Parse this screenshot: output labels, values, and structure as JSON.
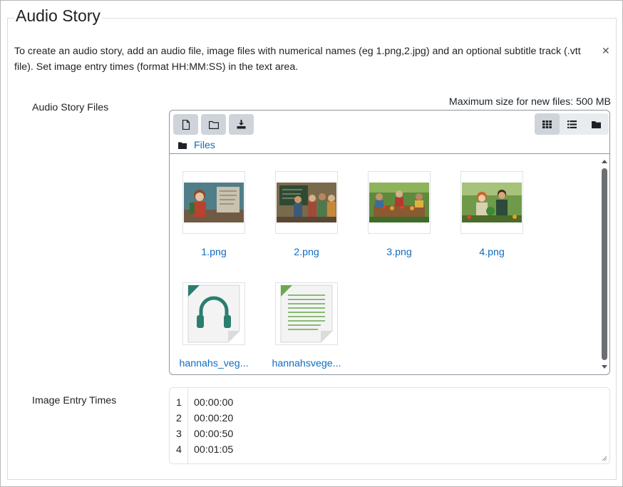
{
  "section": {
    "title": "Audio Story",
    "intro": "To create an audio story, add an audio file, image files with numerical names (eg 1.png,2.jpg) and an optional subtitle track (.vtt file). Set image entry times (format HH:MM:SS) in the text area."
  },
  "files_field": {
    "label": "Audio Story Files",
    "max_size": "Maximum size for new files: 500 MB",
    "breadcrumb": "Files",
    "toolbar": [
      "file-add-icon",
      "folder-add-icon",
      "download-icon"
    ],
    "views": [
      "grid-view-icon",
      "list-view-icon",
      "tree-view-icon"
    ],
    "active_view": "grid-view-icon",
    "files": [
      {
        "name": "1.png",
        "type": "image"
      },
      {
        "name": "2.png",
        "type": "image"
      },
      {
        "name": "3.png",
        "type": "image"
      },
      {
        "name": "4.png",
        "type": "image"
      },
      {
        "name": "hannahs_veg...",
        "type": "audio"
      },
      {
        "name": "hannahsvege...",
        "type": "text"
      }
    ]
  },
  "times_field": {
    "label": "Image Entry Times",
    "lines": [
      {
        "num": "1",
        "text": "00:00:00"
      },
      {
        "num": "2",
        "text": "00:00:20"
      },
      {
        "num": "3",
        "text": "00:00:50"
      },
      {
        "num": "4",
        "text": "00:01:05"
      }
    ]
  },
  "colors": {
    "link": "#0f6cbf",
    "audio_icon": "#2a7e6f",
    "text_icon": "#6aa84f"
  }
}
